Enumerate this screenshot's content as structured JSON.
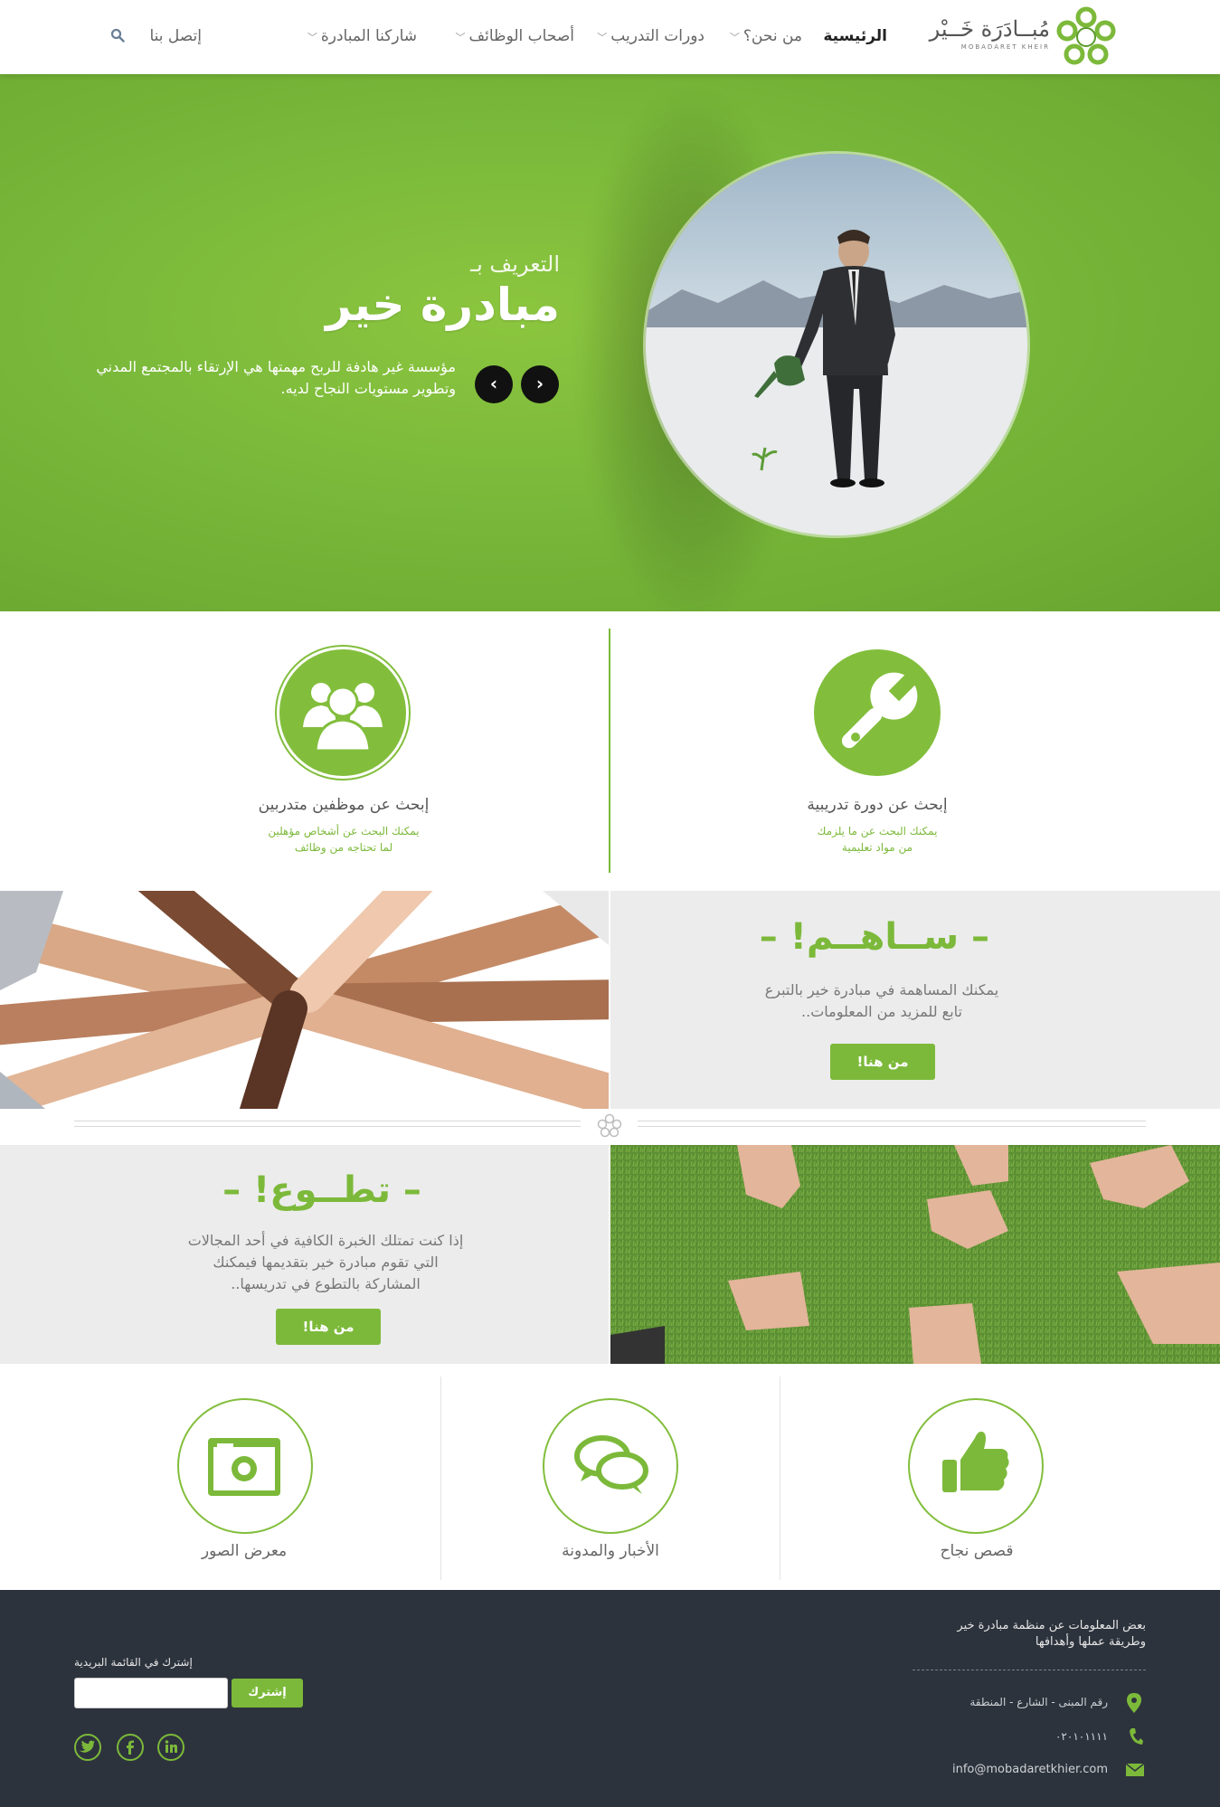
{
  "nav": {
    "logo_ar": "مُبــادَرَة خَــيْر",
    "logo_en": "MOBADARET KHEIR",
    "home": "الرئيسية",
    "about": "من نحن؟",
    "courses": "دورات التدريب",
    "employers": "أصحاب الوظائف",
    "share": "شاركنا المبادرة",
    "contact": "إتصل بنا"
  },
  "hero": {
    "subtitle": "التعريف بـ",
    "title": "مبادرة خير",
    "description": "مؤسسة غير هادفة للربح مهمتها هي الإرتقاء بالمجتمع المدني وتطوير مستويات النجاح لديه.",
    "prev_arrow": "‹",
    "next_arrow": "›"
  },
  "search": {
    "course": {
      "title": "إبحث عن دورة تدريبية",
      "desc_line1": "يمكنك البحث عن ما يلزمك",
      "desc_line2": "من مواد تعليمية"
    },
    "employees": {
      "title": "إبحث عن موظفين متدربين",
      "desc_line1": "يمكنك البحث عن أشخاص مؤهلين",
      "desc_line2": "لما تحتاجه من وظائف"
    }
  },
  "contribute": {
    "title": "– ســاهــم! –",
    "line1": "يمكنك المساهمة في مبادرة خير بالتبرع",
    "line2": "تابع للمزيد من المعلومات..",
    "button": "من هنا!"
  },
  "volunteer": {
    "title": "– تطــوع! –",
    "line1": "إذا كنت تمتلك الخبرة الكافية في أحد المجالات",
    "line2": "التي تقوم مبادرة خير بتقديمها فيمكنك",
    "line3": "المشاركة بالتطوع في تدريسها..",
    "button": "من هنا!"
  },
  "features": {
    "success": "قصص نجاح",
    "news": "الأخبار والمدونة",
    "gallery": "معرض الصور"
  },
  "footer": {
    "about_line1": "بعض المعلومات عن منظمة مبادرة خير",
    "about_line2": "وطريقة عملها وأهدافها",
    "address": "رقم المبنى - الشارع - المنطقة",
    "phone": "٠٢٠١٠١١١١",
    "email": "info@mobadaretkhier.com",
    "newsletter_label": "إشترك في القائمة البريدية",
    "subscribe_button": "إشترك",
    "social": [
      "twitter",
      "facebook",
      "linkedin"
    ]
  },
  "colors": {
    "brand_green": "#7cb93a",
    "footer_bg": "#2d333d",
    "gray_panel": "#ececec"
  }
}
